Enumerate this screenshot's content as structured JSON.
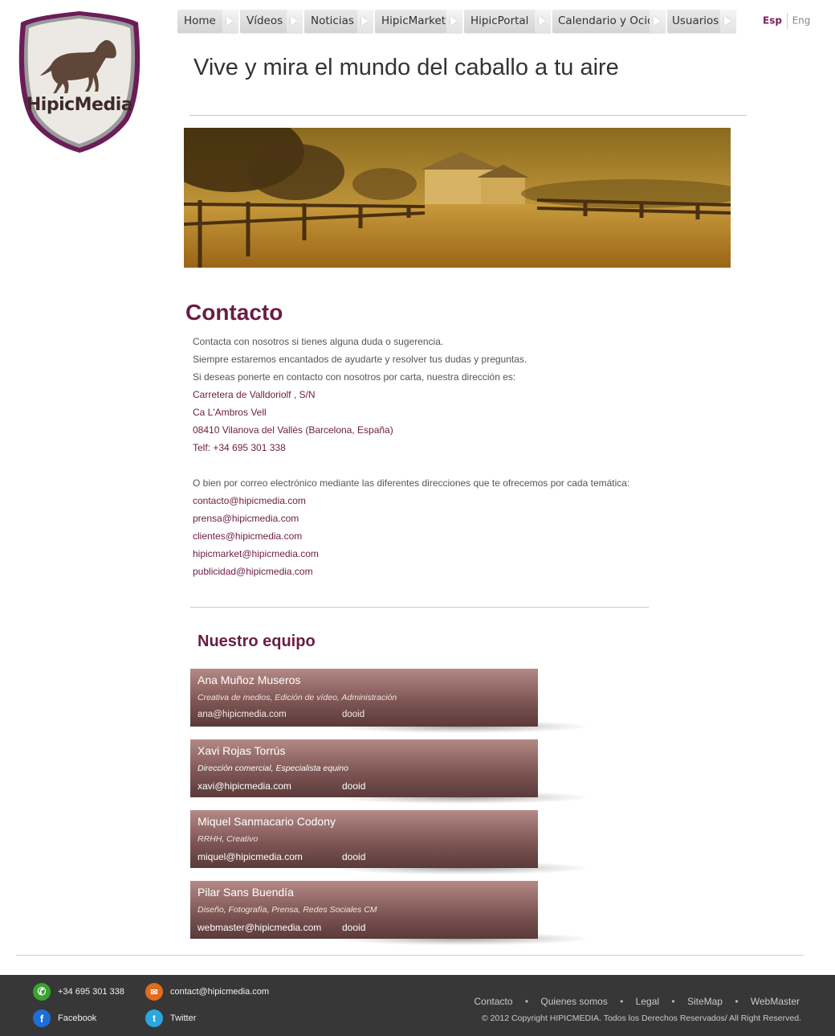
{
  "logo": {
    "text": "HipicMedia"
  },
  "nav": {
    "items": [
      {
        "label": "Home"
      },
      {
        "label": "Vídeos"
      },
      {
        "label": "Noticias"
      },
      {
        "label": "HipicMarket"
      },
      {
        "label": "HipicPortal"
      },
      {
        "label": "Calendario y Ocio"
      },
      {
        "label": "Usuarios"
      }
    ]
  },
  "lang": {
    "esp": "Esp",
    "eng": "Eng"
  },
  "headline": "Vive y mira el mundo del caballo a tu aire",
  "contact": {
    "title": "Contacto",
    "lines": [
      "Contacta con nosotros si tienes alguna duda o sugerencia.",
      "Siempre estaremos encantados de ayudarte y resolver tus dudas y preguntas.",
      "Si deseas ponerte en contacto con nosotros por carta, nuestra dirección es:"
    ],
    "address": [
      "Carretera de Valldoriolf , S/N",
      "Ca L'Ambros Vell",
      "08410 Vilanova del Vallès (Barcelona, España)",
      "Telf: +34 695 301 338"
    ],
    "email_intro": "O bien por correo electrónico mediante las diferentes direcciones que te ofrecemos por cada temática:",
    "emails": [
      "contacto@hipicmedia.com",
      "prensa@hipicmedia.com",
      "clientes@hipicmedia.com",
      "hipicmarket@hipicmedia.com",
      "publicidad@hipicmedia.com"
    ]
  },
  "team": {
    "title": "Nuestro equipo",
    "members": [
      {
        "name": "Ana Muñoz Museros",
        "role": "Creativa de medios, Edición de vídeo, Administración",
        "email": "ana@hipicmedia.com",
        "dooid": "dooid"
      },
      {
        "name": "Xavi Rojas Torrús",
        "role": "Dirección comercial, Especialista equino",
        "email": "xavi@hipicmedia.com",
        "dooid": "dooid"
      },
      {
        "name": "Miquel Sanmacario Codony",
        "role": "RRHH, Creativo",
        "email": "miquel@hipicmedia.com",
        "dooid": "dooid"
      },
      {
        "name": "Pilar Sans Buendía",
        "role": "Diseño, Fotografía, Prensa, Redes Sociales CM",
        "email": "webmaster@hipicmedia.com",
        "dooid": "dooid"
      }
    ]
  },
  "footer": {
    "phone": "+34 695 301 338",
    "email": "contact@hipicmedia.com",
    "facebook": "Facebook",
    "twitter": "Twitter",
    "links": [
      "Contacto",
      "Quienes somos",
      "Legal",
      "SiteMap",
      "WebMaster"
    ],
    "separator": "•",
    "copyright": "© 2012 Copyright HIPICMEDIA. Todos los Derechos Reservados/ All Right Reserved."
  },
  "colors": {
    "brand": "#6b1d43",
    "footer_bg": "#373737",
    "phone_icon": "#3aa32e",
    "email_icon": "#e36b1e",
    "facebook_icon": "#1c6fd8",
    "twitter_icon": "#2aa7e0"
  }
}
